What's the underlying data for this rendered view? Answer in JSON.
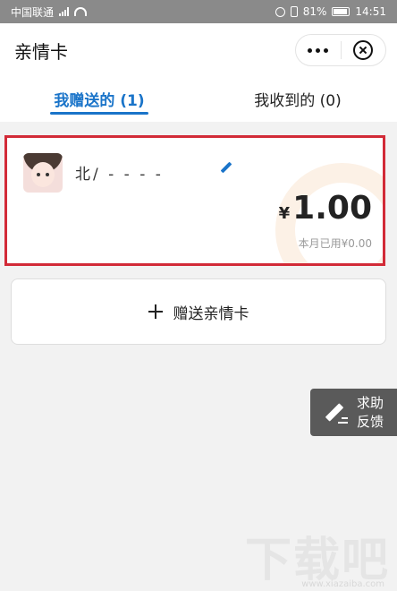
{
  "status_bar": {
    "carrier": "中国联通",
    "battery": "81%",
    "time": "14:51"
  },
  "nav": {
    "title": "亲情卡"
  },
  "tabs": [
    {
      "label": "我赠送的 (1)",
      "active": true
    },
    {
      "label": "我收到的 (0)",
      "active": false
    }
  ],
  "card": {
    "recipient_name": "北/ - - - -",
    "currency_symbol": "¥",
    "amount": "1.00",
    "used_this_month": "本月已用¥0.00",
    "highlight_color": "#d22a37"
  },
  "send_button": {
    "label": "赠送亲情卡"
  },
  "feedback": {
    "line1": "求助",
    "line2": "反馈"
  },
  "watermark": {
    "text": "下载吧",
    "url": "www.xiazaiba.com"
  },
  "colors": {
    "accent": "#1a74c9",
    "status_bar": "#8a8a8a"
  }
}
